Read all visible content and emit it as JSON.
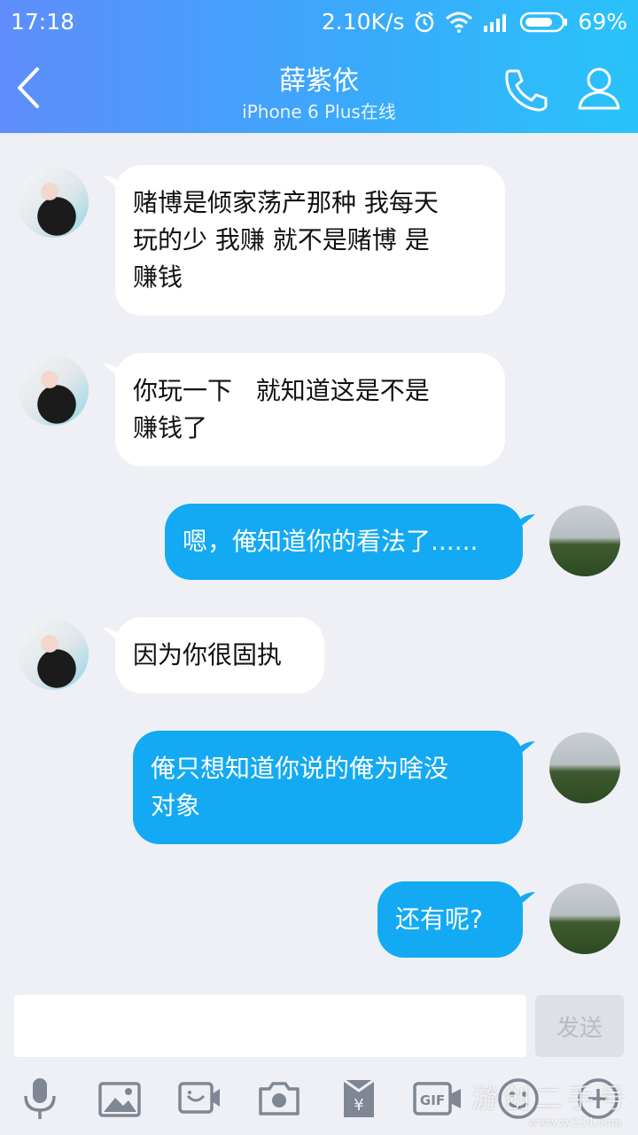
{
  "status_bar": {
    "time": "17:18",
    "network_speed": "2.10K/s",
    "battery": "69%",
    "icons": [
      "alarm-icon",
      "wifi-icon",
      "signal-icon",
      "battery-icon"
    ]
  },
  "header": {
    "title": "薛紫依",
    "subtitle": "iPhone 6 Plus在线",
    "back_icon": "chevron-left-icon",
    "call_icon": "phone-icon",
    "profile_icon": "user-icon"
  },
  "messages": [
    {
      "from": "them",
      "text": "赌博是倾家荡产那种 我每天\n玩的少 我赚 就不是赌博 是\n赚钱"
    },
    {
      "from": "them",
      "text": "你玩一下   就知道这是不是\n赚钱了"
    },
    {
      "from": "me",
      "text": "嗯，俺知道你的看法了......"
    },
    {
      "from": "them",
      "text": "因为你很固执"
    },
    {
      "from": "me",
      "text": "俺只想知道你说的俺为啥没\n对象"
    },
    {
      "from": "me",
      "text": "还有呢?"
    }
  ],
  "composer": {
    "input_value": "",
    "send_label": "发送"
  },
  "toolbar": [
    "microphone-icon",
    "image-icon",
    "video-call-icon",
    "camera-icon",
    "red-packet-icon",
    "gif-icon",
    "emoji-icon",
    "plus-icon"
  ],
  "watermark": {
    "text": "游创二手号",
    "url": "www.zy234.com"
  },
  "colors": {
    "header_gradient_start": "#5f8dfb",
    "header_gradient_end": "#29c3fb",
    "outgoing_bubble": "#13aaf3",
    "incoming_bubble": "#ffffff",
    "background": "#eef0f6"
  }
}
